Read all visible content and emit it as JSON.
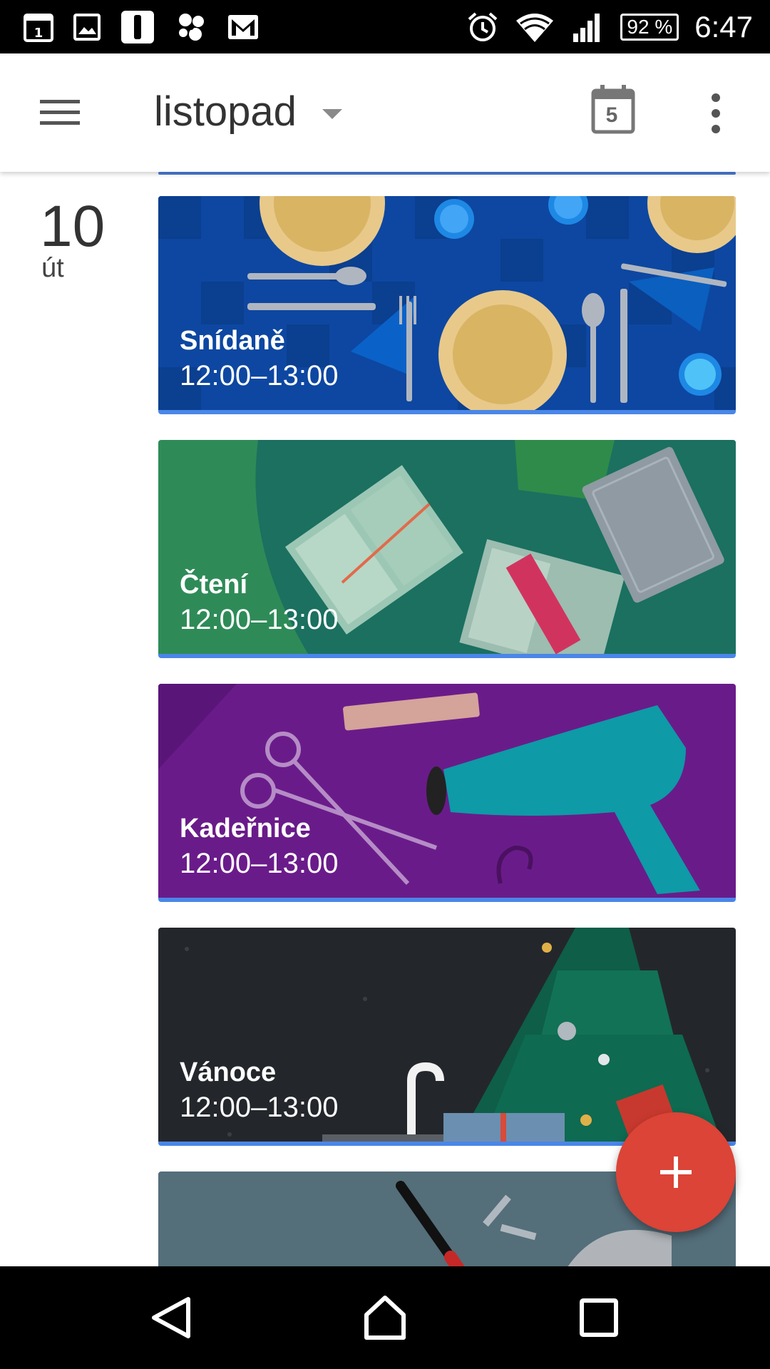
{
  "status_bar": {
    "time": "6:47",
    "battery": "92 %",
    "icons": [
      "calendar-notification-icon",
      "image-notification-icon",
      "app-notification-icon",
      "pinwheel-notification-icon",
      "gmail-notification-icon",
      "alarm-icon",
      "wifi-icon",
      "signal-icon",
      "battery-icon"
    ]
  },
  "app_bar": {
    "title": "listopad",
    "today_number": "5",
    "icons": [
      "menu-icon",
      "dropdown-caret-icon",
      "today-calendar-icon",
      "more-vert-icon"
    ]
  },
  "day": {
    "number": "10",
    "name": "út"
  },
  "events": [
    {
      "title": "Snídaně",
      "time": "12:00–13:00",
      "color": "#0d47a1"
    },
    {
      "title": "Čtení",
      "time": "12:00–13:00",
      "color": "#1e7d5a"
    },
    {
      "title": "Kadeřnice",
      "time": "12:00–13:00",
      "color": "#6a1b8a"
    },
    {
      "title": "Vánoce",
      "time": "12:00–13:00",
      "color": "#23272b"
    }
  ],
  "colors": {
    "accent": "#4a86e8",
    "fab": "#db4437"
  },
  "nav_bar": {
    "icons": [
      "back-icon",
      "home-icon",
      "recents-icon"
    ]
  }
}
